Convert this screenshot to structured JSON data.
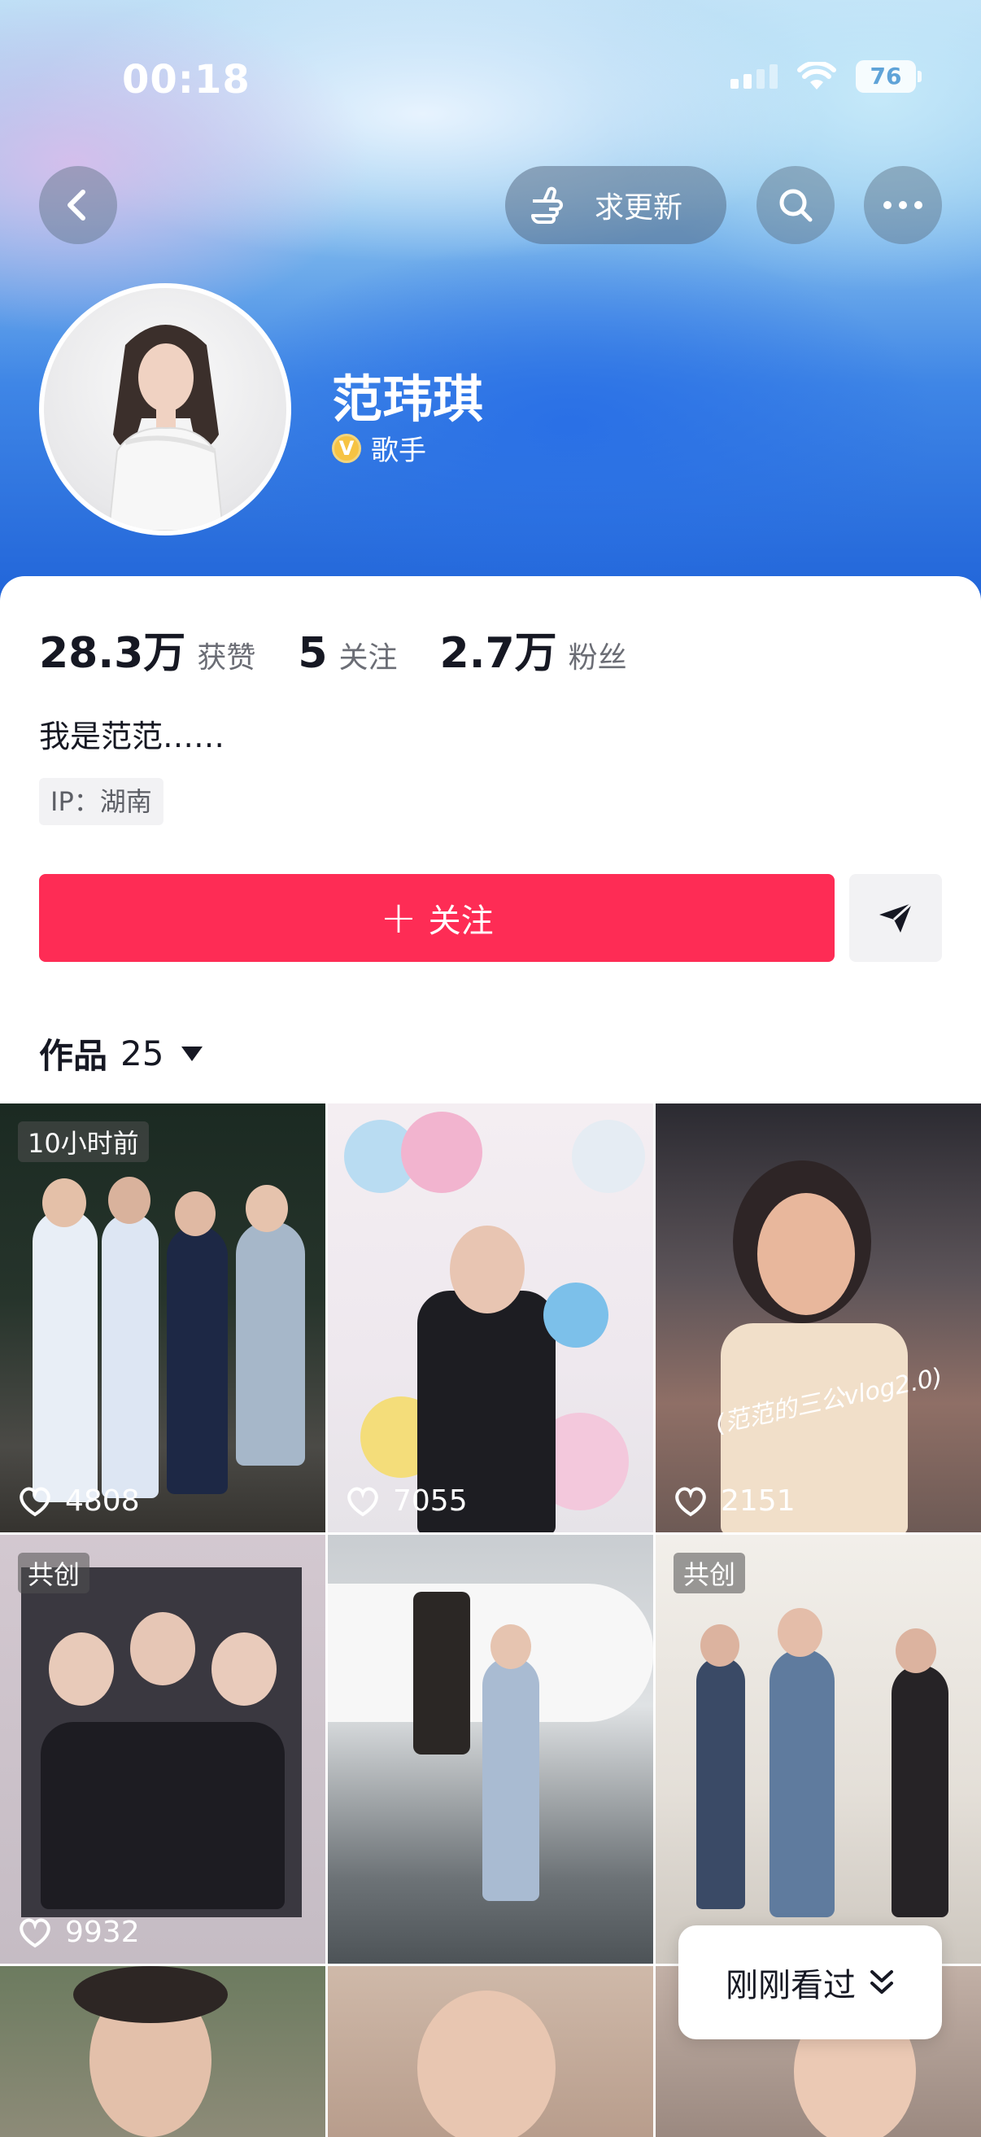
{
  "status_bar": {
    "time": "00:18",
    "battery": "76"
  },
  "header": {
    "request_update_label": "求更新"
  },
  "profile": {
    "name": "范玮琪",
    "verified_badge": "V",
    "verified_title": "歌手",
    "stats": [
      {
        "value": "28.3万",
        "label": "获赞"
      },
      {
        "value": "5",
        "label": "关注"
      },
      {
        "value": "2.7万",
        "label": "粉丝"
      }
    ],
    "bio": "我是范范……",
    "ip": "IP：湖南"
  },
  "actions": {
    "follow_label": "关注",
    "follow_plus": "+"
  },
  "works": {
    "label": "作品",
    "count": "25"
  },
  "videos": [
    {
      "tag": "10小时前",
      "likes": "4808"
    },
    {
      "tag": "",
      "likes": "7055"
    },
    {
      "tag": "",
      "likes": "2151",
      "caption": "(范范的三公vlog2.0)"
    },
    {
      "tag": "共创",
      "likes": "9932"
    },
    {
      "tag": "",
      "likes": ""
    },
    {
      "tag": "共创",
      "likes": ""
    },
    {
      "tag": "",
      "likes": ""
    },
    {
      "tag": "",
      "likes": ""
    },
    {
      "tag": "",
      "likes": ""
    }
  ],
  "recently_viewed": {
    "label": "刚刚看过"
  },
  "colors": {
    "accent": "#fe2c55",
    "verify": "#f6c344"
  }
}
